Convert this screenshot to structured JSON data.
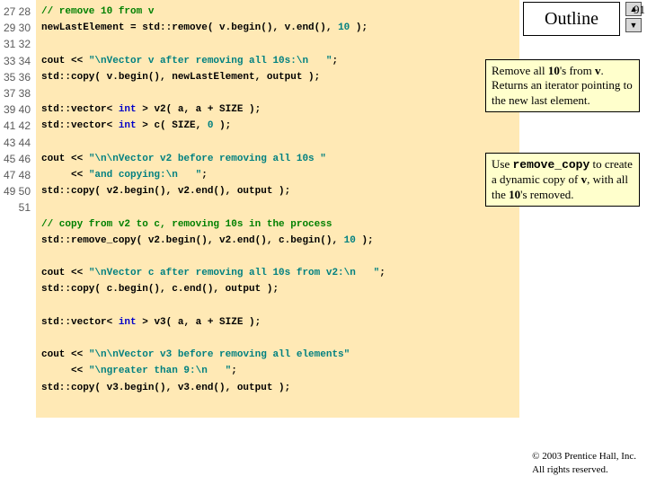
{
  "page_number": "91",
  "outline_label": "Outline",
  "line_start": 27,
  "line_end": 51,
  "code": {
    "l27": "// remove 10 from v",
    "l28a": "newLastElement = std::remove( v.begin(), v.end(), ",
    "l28b": "10",
    "l28c": " );",
    "l30a": "cout << ",
    "l30b": "\"\\nVector v after removing all 10s:\\n   \"",
    "l30c": ";",
    "l31": "std::copy( v.begin(), newLastElement, output );",
    "l33a": "std::vector< ",
    "l33b": "int",
    "l33c": " > v2( a, a + SIZE );",
    "l34a": "std::vector< ",
    "l34b": "int",
    "l34c": " > c( SIZE, ",
    "l34d": "0",
    "l34e": " );",
    "l36a": "cout << ",
    "l36b": "\"\\n\\nVector v2 before removing all 10s \"",
    "l37a": "     << ",
    "l37b": "\"and copying:\\n   \"",
    "l37c": ";",
    "l38": "std::copy( v2.begin(), v2.end(), output );",
    "l40": "// copy from v2 to c, removing 10s in the process",
    "l41a": "std::remove_copy( v2.begin(), v2.end(), c.begin(), ",
    "l41b": "10",
    "l41c": " );",
    "l43a": "cout << ",
    "l43b": "\"\\nVector c after removing all 10s from v2:\\n   \"",
    "l43c": ";",
    "l44": "std::copy( c.begin(), c.end(), output );",
    "l46a": "std::vector< ",
    "l46b": "int",
    "l46c": " > v3( a, a + SIZE );",
    "l48a": "cout << ",
    "l48b": "\"\\n\\nVector v3 before removing all elements\"",
    "l49a": "     << ",
    "l49b": "\"\\ngreater than 9:\\n   \"",
    "l49c": ";",
    "l50": "std::copy( v3.begin(), v3.end(), output );"
  },
  "annotations": {
    "a1_pre": "Remove all ",
    "a1_b1": "10",
    "a1_mid": "'s from ",
    "a1_b2": "v",
    "a1_post": ". Returns an iterator pointing to the new last element.",
    "a2_pre": "Use ",
    "a2_code": "remove_copy",
    "a2_mid": " to create a dynamic copy of ",
    "a2_b1": "v",
    "a2_mid2": ", with all the ",
    "a2_b2": "10",
    "a2_post": "'s removed."
  },
  "copyright": {
    "line1": "© 2003 Prentice Hall, Inc.",
    "line2": "All rights reserved."
  }
}
